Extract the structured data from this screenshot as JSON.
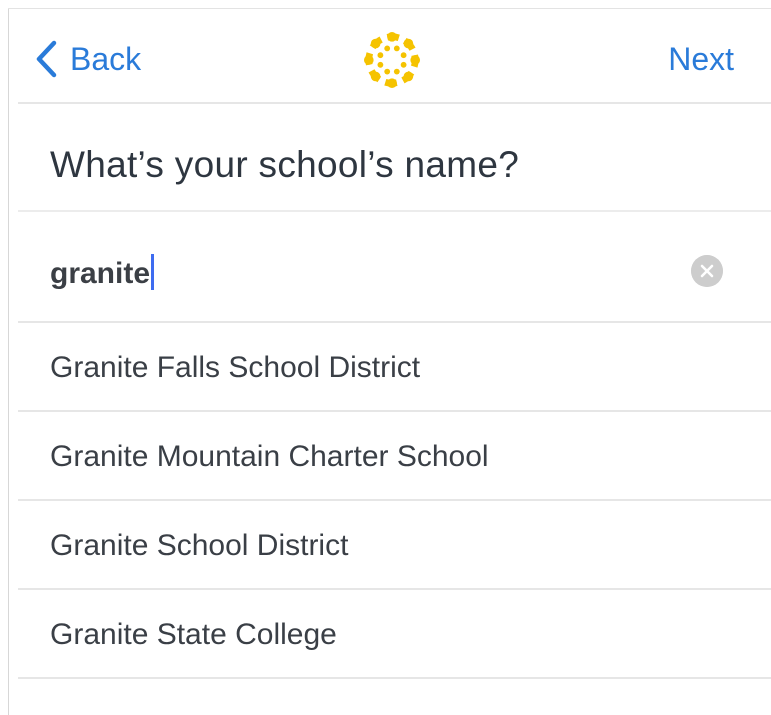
{
  "navbar": {
    "back_label": "Back",
    "next_label": "Next",
    "logo_icon": "canvas-logo-icon",
    "accent_color": "#2a7bd9",
    "logo_color": "#f5c300"
  },
  "page": {
    "title": "What’s your school’s name?"
  },
  "search": {
    "value": "granite",
    "clear_icon": "clear-icon"
  },
  "results": [
    {
      "label": "Granite Falls School District"
    },
    {
      "label": "Granite Mountain Charter School"
    },
    {
      "label": "Granite School District"
    },
    {
      "label": "Granite State College"
    }
  ]
}
